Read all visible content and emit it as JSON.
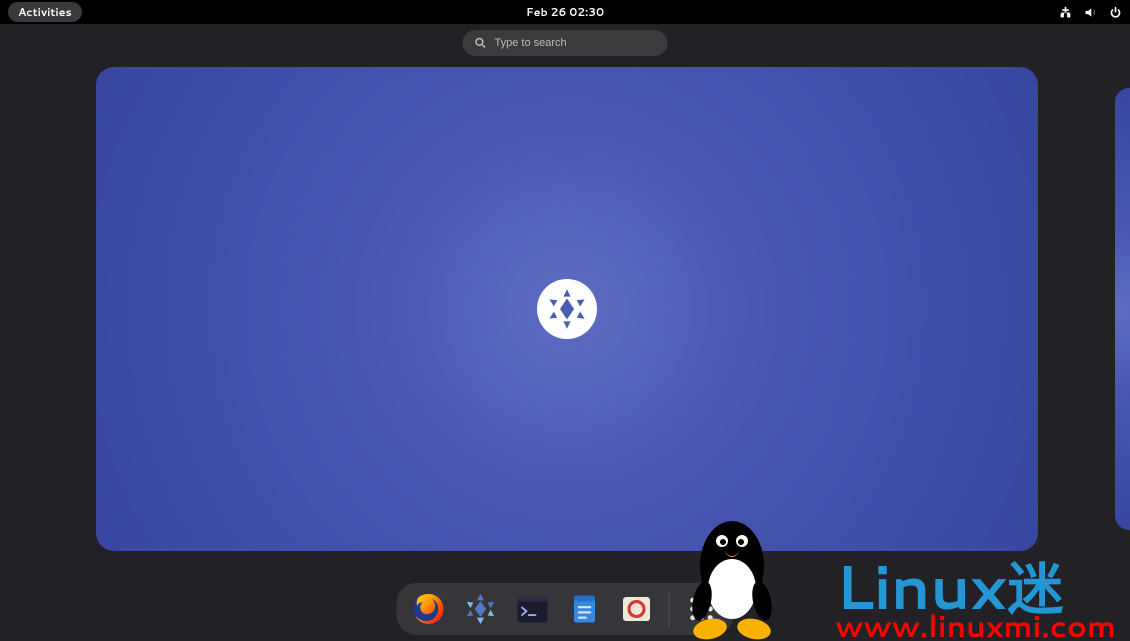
{
  "topbar": {
    "activities_label": "Activities",
    "clock": "Feb 26  02:30",
    "status_icons": [
      "network-wired-icon",
      "volume-icon",
      "power-icon"
    ]
  },
  "search": {
    "placeholder": "Type to search"
  },
  "workspaces": {
    "main": {
      "name": "workspace-1"
    },
    "next": {
      "name": "workspace-2"
    }
  },
  "dash": {
    "apps": [
      {
        "name": "firefox",
        "icon": "firefox-icon"
      },
      {
        "name": "nixos-manual",
        "icon": "snowflake-icon"
      },
      {
        "name": "terminal",
        "icon": "terminal-icon"
      },
      {
        "name": "files",
        "icon": "files-icon"
      },
      {
        "name": "help",
        "icon": "help-icon"
      }
    ],
    "apps_grid_label": "Show Applications"
  },
  "watermark": {
    "brand_latin": "Linux",
    "brand_cjk": "迷",
    "url": "www.linuxmi.com"
  }
}
